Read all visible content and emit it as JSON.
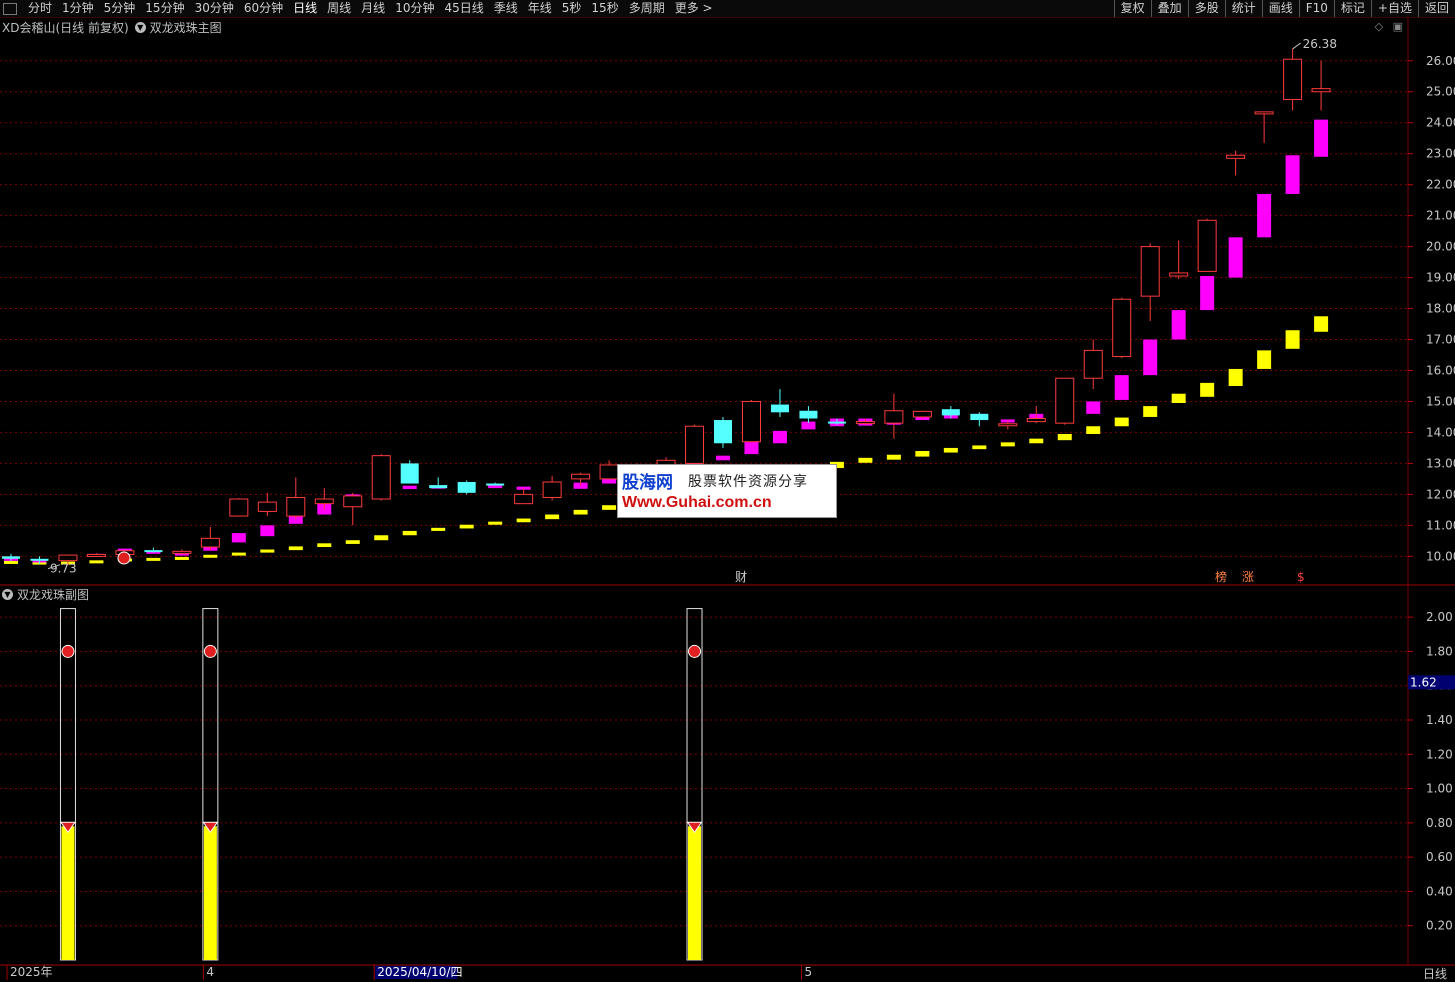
{
  "toolbar": {
    "periods": [
      "分时",
      "1分钟",
      "5分钟",
      "15分钟",
      "30分钟",
      "60分钟",
      "日线",
      "周线",
      "月线",
      "10分钟",
      "45日线",
      "季线",
      "年线",
      "5秒",
      "15秒",
      "多周期",
      "更多 >"
    ],
    "active_period": "日线",
    "actions": [
      "复权",
      "叠加",
      "多股",
      "统计",
      "画线",
      "F10",
      "标记",
      "+自选",
      "返回"
    ]
  },
  "main_panel": {
    "stock_title": "XD会稽山(日线 前复权)",
    "indicator_name": "双龙戏珠主图",
    "high_marker": "26.38",
    "low_marker": "9.73",
    "event_tags": [
      {
        "label": "财",
        "color": "#d0d0d0"
      },
      {
        "label": "榜",
        "color": "#ff8040"
      },
      {
        "label": "涨",
        "color": "#ff8040"
      },
      {
        "label": "$",
        "color": "#ff4040"
      }
    ]
  },
  "sub_panel": {
    "indicator_name": "双龙戏珠副图",
    "current_value": "1.62",
    "signal_bars": [
      {
        "index": 2,
        "value": 0.78
      },
      {
        "index": 7,
        "value": 0.78
      },
      {
        "index": 24,
        "value": 0.78
      }
    ]
  },
  "x_axis": {
    "labels": [
      {
        "text": "2025年",
        "index": 0
      },
      {
        "text": "4",
        "index": 7
      },
      {
        "text": "2025/04/10/四",
        "index": 13
      },
      {
        "text": "5",
        "index": 28
      }
    ],
    "period_label": "日线"
  },
  "colors": {
    "up": "#ff3b3b",
    "down": "#54ffff",
    "magenta": "#ff00ff",
    "yellow": "#ffff00",
    "grid": "#7a0000",
    "axis_text": "#c8c8c8"
  },
  "watermark": {
    "logo": "股海网",
    "tagline": "股票软件资源分享",
    "url": "Www.Guhai.com.cn"
  },
  "chart_data": [
    {
      "type": "candlestick",
      "title": "双龙戏珠主图",
      "ylim": [
        9.3,
        26.8
      ],
      "yticks": [
        10,
        11,
        12,
        13,
        14,
        15,
        16,
        17,
        18,
        19,
        20,
        21,
        22,
        23,
        24,
        25,
        26
      ],
      "ohlc": [
        [
          10.0,
          10.08,
          9.85,
          9.92
        ],
        [
          9.92,
          10.0,
          9.75,
          9.86
        ],
        [
          9.86,
          10.05,
          9.73,
          10.04
        ],
        [
          10.04,
          10.1,
          10.0,
          10.06
        ],
        [
          10.06,
          10.2,
          10.0,
          10.18
        ],
        [
          10.2,
          10.28,
          10.12,
          10.15
        ],
        [
          10.15,
          10.22,
          10.08,
          10.16
        ],
        [
          10.3,
          10.95,
          10.2,
          10.58
        ],
        [
          11.3,
          11.88,
          11.3,
          11.85
        ],
        [
          11.45,
          12.05,
          11.3,
          11.75
        ],
        [
          11.3,
          12.55,
          11.2,
          11.9
        ],
        [
          11.7,
          12.2,
          11.5,
          11.85
        ],
        [
          11.6,
          12.05,
          11.0,
          11.95
        ],
        [
          11.85,
          13.3,
          11.8,
          13.25
        ],
        [
          13.0,
          13.1,
          12.4,
          12.35
        ],
        [
          12.3,
          12.55,
          12.2,
          12.2
        ],
        [
          12.4,
          12.45,
          12.0,
          12.05
        ],
        [
          12.35,
          12.38,
          12.3,
          12.33
        ],
        [
          11.7,
          12.2,
          11.7,
          12.0
        ],
        [
          11.9,
          12.6,
          11.8,
          12.4
        ],
        [
          12.5,
          12.7,
          12.3,
          12.65
        ],
        [
          12.5,
          13.1,
          12.5,
          12.95
        ],
        [
          12.75,
          13.0,
          12.7,
          12.75
        ],
        [
          12.9,
          13.2,
          12.8,
          13.1
        ],
        [
          13.0,
          14.25,
          13.0,
          14.2
        ],
        [
          14.4,
          14.5,
          13.5,
          13.65
        ],
        [
          13.7,
          15.05,
          13.7,
          15.0
        ],
        [
          14.9,
          15.4,
          14.5,
          14.65
        ],
        [
          14.7,
          14.85,
          14.3,
          14.45
        ],
        [
          14.35,
          14.45,
          14.25,
          14.3
        ],
        [
          14.3,
          14.45,
          14.25,
          14.35
        ],
        [
          14.3,
          15.25,
          13.8,
          14.7
        ],
        [
          14.5,
          14.7,
          14.45,
          14.68
        ],
        [
          14.75,
          14.85,
          14.45,
          14.55
        ],
        [
          14.6,
          14.65,
          14.2,
          14.4
        ],
        [
          14.28,
          14.38,
          14.1,
          14.28
        ],
        [
          14.35,
          14.85,
          14.3,
          14.45
        ],
        [
          14.3,
          15.7,
          14.25,
          15.75
        ],
        [
          15.75,
          17.0,
          15.4,
          16.65
        ],
        [
          16.45,
          18.35,
          16.4,
          18.3
        ],
        [
          18.4,
          20.1,
          17.6,
          20.0
        ],
        [
          19.05,
          20.2,
          18.95,
          19.15
        ],
        [
          19.2,
          20.9,
          19.2,
          20.85
        ],
        [
          22.85,
          23.1,
          22.3,
          22.95
        ],
        [
          24.3,
          24.35,
          23.35,
          24.35
        ],
        [
          24.75,
          26.38,
          24.4,
          26.05
        ],
        [
          25.0,
          26.0,
          24.4,
          25.1
        ]
      ],
      "magenta_bands": [
        [
          9.95,
          9.9
        ],
        [
          9.9,
          9.85
        ],
        [
          9.98,
          9.93
        ],
        [
          10.08,
          10.03
        ],
        [
          10.25,
          10.12
        ],
        [
          10.18,
          10.08
        ],
        [
          10.12,
          10.05
        ],
        [
          10.32,
          10.18
        ],
        [
          10.75,
          10.45
        ],
        [
          11.0,
          10.65
        ],
        [
          11.45,
          11.05
        ],
        [
          11.7,
          11.35
        ],
        [
          12.0,
          11.65
        ],
        [
          12.2,
          11.9
        ],
        [
          12.28,
          12.17
        ],
        [
          12.28,
          12.22
        ],
        [
          12.35,
          12.1
        ],
        [
          12.3,
          12.25
        ],
        [
          12.25,
          12.15
        ],
        [
          12.22,
          12.12
        ],
        [
          12.38,
          12.18
        ],
        [
          12.5,
          12.35
        ],
        [
          12.62,
          12.45
        ],
        [
          12.8,
          12.6
        ],
        [
          13.05,
          12.8
        ],
        [
          13.25,
          13.1
        ],
        [
          13.75,
          13.3
        ],
        [
          14.05,
          13.65
        ],
        [
          14.35,
          14.1
        ],
        [
          14.45,
          14.2
        ],
        [
          14.45,
          14.22
        ],
        [
          14.5,
          14.25
        ],
        [
          14.6,
          14.4
        ],
        [
          14.6,
          14.45
        ],
        [
          14.6,
          14.45
        ],
        [
          14.42,
          14.32
        ],
        [
          14.6,
          14.4
        ],
        [
          14.65,
          14.45
        ],
        [
          15.0,
          14.6
        ],
        [
          15.85,
          15.05
        ],
        [
          17.0,
          15.85
        ],
        [
          17.95,
          17.0
        ],
        [
          19.05,
          17.95
        ],
        [
          20.3,
          19.0
        ],
        [
          21.7,
          20.3
        ],
        [
          22.95,
          21.7
        ],
        [
          24.1,
          22.9
        ]
      ],
      "yellow_bands": [
        [
          9.85,
          9.78
        ],
        [
          9.83,
          9.78
        ],
        [
          9.83,
          9.78
        ],
        [
          9.87,
          9.8
        ],
        [
          9.93,
          9.86
        ],
        [
          9.95,
          9.89
        ],
        [
          9.98,
          9.92
        ],
        [
          10.05,
          9.97
        ],
        [
          10.12,
          10.04
        ],
        [
          10.22,
          10.12
        ],
        [
          10.32,
          10.2
        ],
        [
          10.42,
          10.3
        ],
        [
          10.52,
          10.4
        ],
        [
          10.68,
          10.52
        ],
        [
          10.82,
          10.68
        ],
        [
          10.92,
          10.82
        ],
        [
          11.02,
          10.9
        ],
        [
          11.12,
          11.02
        ],
        [
          11.22,
          11.1
        ],
        [
          11.35,
          11.2
        ],
        [
          11.5,
          11.35
        ],
        [
          11.65,
          11.5
        ],
        [
          11.8,
          11.65
        ],
        [
          11.95,
          11.8
        ],
        [
          12.1,
          11.95
        ],
        [
          12.28,
          12.1
        ],
        [
          12.45,
          12.28
        ],
        [
          12.65,
          12.45
        ],
        [
          12.85,
          12.65
        ],
        [
          13.05,
          12.85
        ],
        [
          13.18,
          13.02
        ],
        [
          13.28,
          13.12
        ],
        [
          13.4,
          13.22
        ],
        [
          13.5,
          13.35
        ],
        [
          13.58,
          13.46
        ],
        [
          13.68,
          13.55
        ],
        [
          13.8,
          13.65
        ],
        [
          13.95,
          13.75
        ],
        [
          14.2,
          13.95
        ],
        [
          14.48,
          14.2
        ],
        [
          14.85,
          14.5
        ],
        [
          15.25,
          14.95
        ],
        [
          15.6,
          15.15
        ],
        [
          16.05,
          15.5
        ],
        [
          16.65,
          16.05
        ],
        [
          17.3,
          16.7
        ],
        [
          17.75,
          17.25
        ]
      ]
    },
    {
      "type": "bar",
      "title": "双龙戏珠副图",
      "ylim": [
        0,
        2.1
      ],
      "yticks": [
        0.2,
        0.4,
        0.6,
        0.8,
        1.0,
        1.2,
        1.4,
        1.6,
        1.8,
        2.0
      ],
      "signal_outline_top": 2.05,
      "ball_level": 1.8
    }
  ]
}
